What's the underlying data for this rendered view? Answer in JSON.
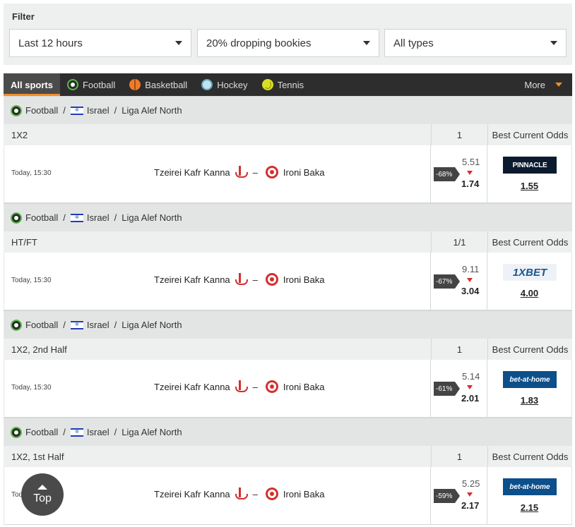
{
  "filter": {
    "title": "Filter",
    "time": "Last 12 hours",
    "threshold": "20% dropping bookies",
    "types": "All types"
  },
  "nav": {
    "tabs": [
      {
        "label": "All sports",
        "icon": "none",
        "active": true
      },
      {
        "label": "Football",
        "icon": "football-icon"
      },
      {
        "label": "Basketball",
        "icon": "basketball-icon"
      },
      {
        "label": "Hockey",
        "icon": "hockey-icon"
      },
      {
        "label": "Tennis",
        "icon": "tennis-icon"
      }
    ],
    "more": "More",
    "accent": "#f28c28"
  },
  "events": [
    {
      "sport": "Football",
      "country": "Israel",
      "league": "Liga Alef North",
      "market": "1X2",
      "outcome": "1",
      "best_header": "Best Current Odds",
      "time": "Today, 15:30",
      "home": "Tzeirei Kafr Kanna",
      "away": "Ironi Baka",
      "drop": "-68%",
      "old_odd": "5.51",
      "new_odd": "1.74",
      "bookmaker": "PINNACLE",
      "best_odd": "1.55"
    },
    {
      "sport": "Football",
      "country": "Israel",
      "league": "Liga Alef North",
      "market": "HT/FT",
      "outcome": "1/1",
      "best_header": "Best Current Odds",
      "time": "Today, 15:30",
      "home": "Tzeirei Kafr Kanna",
      "away": "Ironi Baka",
      "drop": "-67%",
      "old_odd": "9.11",
      "new_odd": "3.04",
      "bookmaker": "1XBET",
      "best_odd": "4.00"
    },
    {
      "sport": "Football",
      "country": "Israel",
      "league": "Liga Alef North",
      "market": "1X2, 2nd Half",
      "outcome": "1",
      "best_header": "Best Current Odds",
      "time": "Today, 15:30",
      "home": "Tzeirei Kafr Kanna",
      "away": "Ironi Baka",
      "drop": "-61%",
      "old_odd": "5.14",
      "new_odd": "2.01",
      "bookmaker": "bet-at-home",
      "best_odd": "1.83"
    },
    {
      "sport": "Football",
      "country": "Israel",
      "league": "Liga Alef North",
      "market": "1X2, 1st Half",
      "outcome": "1",
      "best_header": "Best Current Odds",
      "time": "Today, 15:30",
      "home": "Tzeirei Kafr Kanna",
      "away": "Ironi Baka",
      "drop": "-59%",
      "old_odd": "5.25",
      "new_odd": "2.17",
      "bookmaker": "bet-at-home",
      "best_odd": "2.15"
    }
  ],
  "top_button": "Top"
}
